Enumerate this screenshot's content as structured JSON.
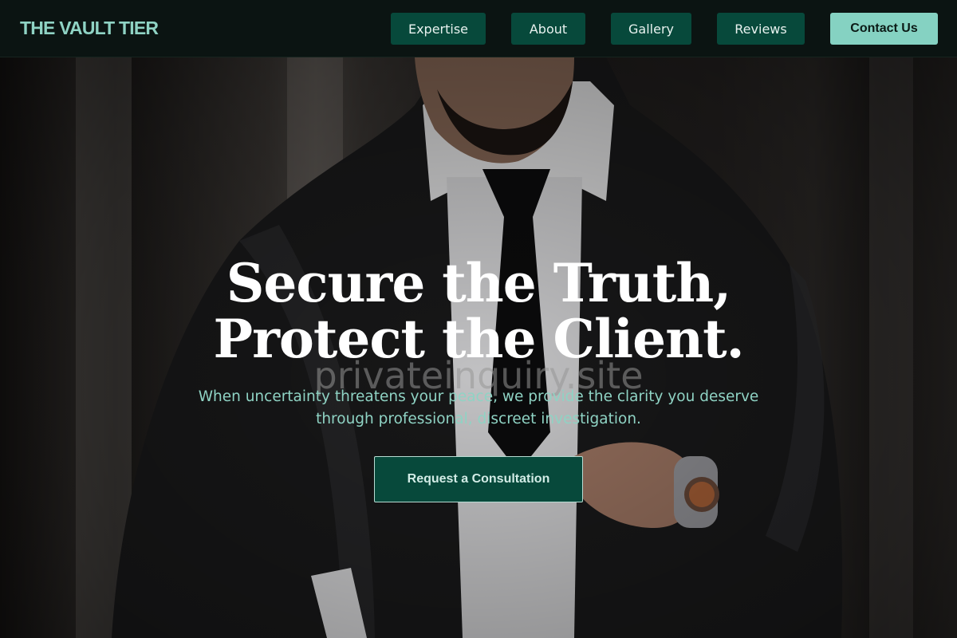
{
  "header": {
    "logo": "THE VAULT TIER",
    "nav": [
      {
        "label": "Expertise"
      },
      {
        "label": "About"
      },
      {
        "label": "Gallery"
      },
      {
        "label": "Reviews"
      }
    ],
    "contact_label": "Contact Us"
  },
  "hero": {
    "title_line1": "Secure the Truth,",
    "title_line2": "Protect the Client.",
    "watermark": "privateinquiry.site",
    "subtitle": "When uncertainty threatens your peace, we provide the clarity you deserve through professional, discreet investigation.",
    "cta_label": "Request a Consultation"
  },
  "colors": {
    "header_bg": "#0b1412",
    "logo": "#8fd3c4",
    "nav_button": "#07493b",
    "contact_button": "#85d2c2",
    "subtitle_text": "#8fd3c4",
    "cta_border": "#b8dcd3"
  }
}
